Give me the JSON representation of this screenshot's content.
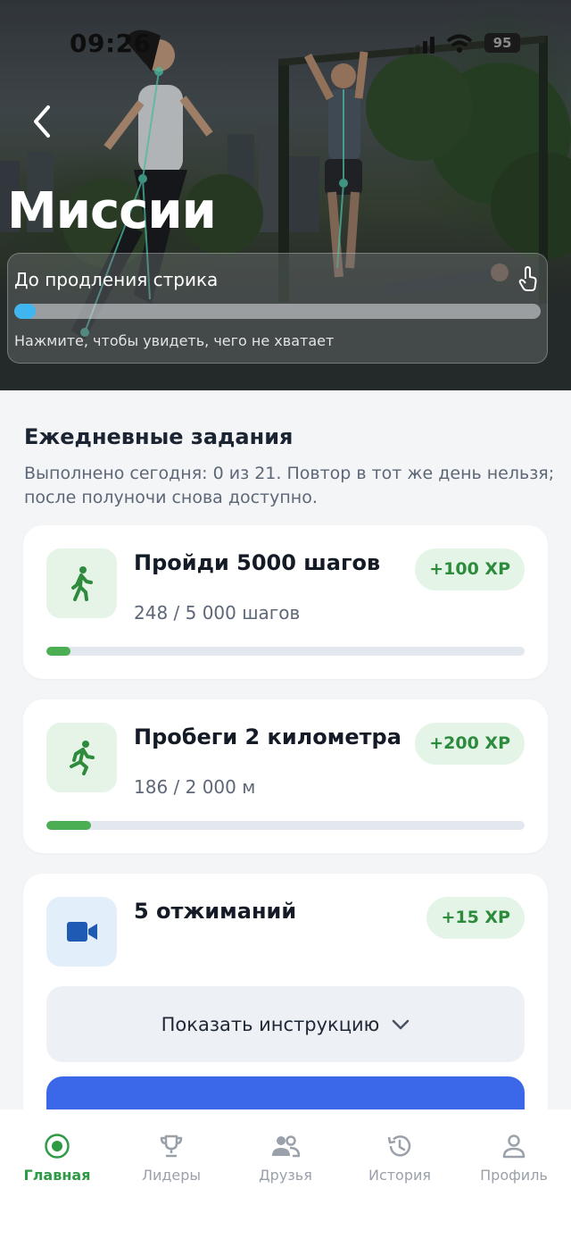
{
  "status_bar": {
    "time": "09:26",
    "battery": "95"
  },
  "header": {
    "title": "Миссии"
  },
  "streak": {
    "label": "До продления стрика",
    "hint": "Нажмите, чтобы увидеть, чего не хватает",
    "progress": 0.04,
    "icon": "tap-hand-icon"
  },
  "daily": {
    "title": "Ежедневные задания",
    "description": "Выполнено сегодня: 0 из 21. Повтор в тот же день нельзя; после полуночи снова доступно."
  },
  "tasks": [
    {
      "name": "Пройди 5000 шагов",
      "progress_text": "248 / 5 000 шагов",
      "xp": "+100 XP",
      "progress": 0.0496,
      "icon": "walking-icon",
      "icon_bg": "#e6f4e8"
    },
    {
      "name": "Пробеги 2 километра",
      "progress_text": "186 / 2 000 м",
      "xp": "+200 XP",
      "progress": 0.093,
      "icon": "running-icon",
      "icon_bg": "#e6f4e8"
    },
    {
      "name": "5 отжиманий",
      "xp": "+15 XP",
      "icon": "video-camera-icon",
      "icon_bg": "#e3eefb",
      "instruction_label": "Показать инструкцию"
    }
  ],
  "tabs": [
    {
      "label": "Главная",
      "icon": "home-target-icon",
      "active": true
    },
    {
      "label": "Лидеры",
      "icon": "trophy-icon",
      "active": false
    },
    {
      "label": "Друзья",
      "icon": "friends-icon",
      "active": false
    },
    {
      "label": "История",
      "icon": "history-icon",
      "active": false
    },
    {
      "label": "Профиль",
      "icon": "profile-icon",
      "active": false
    }
  ],
  "colors": {
    "accent_green": "#2e9a46",
    "progress_green": "#4cae52",
    "streak_blue": "#3fb6f0",
    "primary_button": "#3b68e8"
  }
}
